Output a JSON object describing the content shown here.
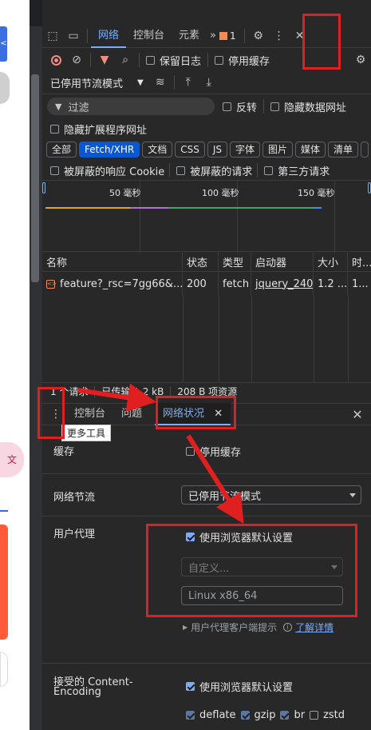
{
  "toolbar": {
    "tabs": [
      "网络",
      "控制台",
      "元素"
    ],
    "more_tabs": "»",
    "issues_count": "1"
  },
  "network_toolbar": {
    "preserve_log": "保留日志",
    "disable_cache": "停用缓存",
    "throttle": "已停用节流模式"
  },
  "filter": {
    "placeholder": "过滤",
    "invert": "反转",
    "hide_data_urls": "隐藏数据网址",
    "hide_extension_urls": "隐藏扩展程序网址"
  },
  "type_chips": [
    "全部",
    "Fetch/XHR",
    "文档",
    "CSS",
    "JS",
    "字体",
    "图片",
    "媒体",
    "清单"
  ],
  "blocked": {
    "blocked_cookies": "被屏蔽的响应 Cookie",
    "blocked_requests": "被屏蔽的请求",
    "third_party": "第三方请求"
  },
  "timeline": {
    "ticks": [
      "50 毫秒",
      "100 毫秒",
      "150 毫秒"
    ]
  },
  "table": {
    "headers": [
      "名称",
      "状态",
      "类型",
      "启动器",
      "大小",
      "时..."
    ],
    "rows": [
      {
        "name": "feature?_rsc=7gg66&...",
        "status": "200",
        "type": "fetch",
        "initiator": "jquery_240",
        "size": "1.2 ...",
        "time": "1..."
      }
    ]
  },
  "status_bar": {
    "requests": "1 个请求",
    "transferred": "已传输 1.2 kB",
    "resources": "208 B 项资源"
  },
  "drawer": {
    "tabs": [
      "控制台",
      "问题",
      "网络状况"
    ],
    "tooltip": "更多工具"
  },
  "conditions": {
    "cache_label": "缓存",
    "cache_option": "停用缓存",
    "throttle_label": "网络节流",
    "throttle_value": "已停用节流模式",
    "ua_label": "用户代理",
    "ua_default": "使用浏览器默认设置",
    "ua_custom_placeholder": "自定义...",
    "ua_value": "Linux x86_64",
    "ua_hints": "用户代理客户端提示",
    "learn_more": "了解详情",
    "encoding_label_1": "接受的 Content-",
    "encoding_label_2": "Encoding",
    "encoding_default": "使用浏览器默认设置",
    "encodings": [
      {
        "name": "deflate",
        "checked": true
      },
      {
        "name": "gzip",
        "checked": true
      },
      {
        "name": "br",
        "checked": true
      },
      {
        "name": "zstd",
        "checked": false
      }
    ]
  },
  "colors": {
    "accent": "#7cacf8",
    "highlight": "#e02020",
    "chip_active": "#0b57d0"
  }
}
